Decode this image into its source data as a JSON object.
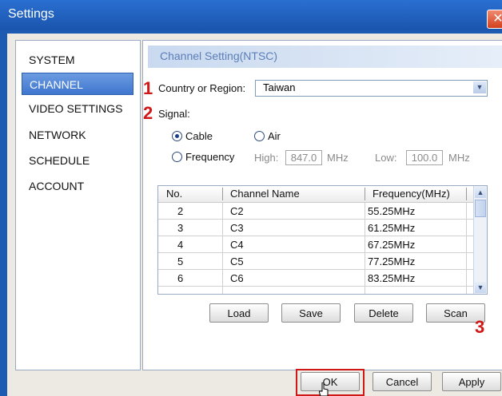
{
  "window": {
    "title": "Settings",
    "close_icon": "close-icon"
  },
  "sidebar": {
    "items": [
      {
        "label": "SYSTEM",
        "active": false
      },
      {
        "label": "CHANNEL",
        "active": true
      },
      {
        "label": "VIDEO SETTINGS",
        "active": false
      },
      {
        "label": "NETWORK",
        "active": false
      },
      {
        "label": "SCHEDULE",
        "active": false
      },
      {
        "label": "ACCOUNT",
        "active": false
      }
    ]
  },
  "panel": {
    "section_title": "Channel Setting(NTSC)",
    "country_label": "Country or Region:",
    "country_value": "Taiwan",
    "signal_label": "Signal:",
    "radio_cable": "Cable",
    "radio_air": "Air",
    "radio_frequency": "Frequency",
    "selected_signal": "Cable",
    "high_label": "High:",
    "high_value": "847.0",
    "high_unit": "MHz",
    "low_label": "Low:",
    "low_value": "100.0",
    "low_unit": "MHz"
  },
  "table": {
    "headers": [
      "No.",
      "Channel Name",
      "Frequency(MHz)"
    ],
    "rows": [
      [
        "2",
        "C2",
        "55.25MHz"
      ],
      [
        "3",
        "C3",
        "61.25MHz"
      ],
      [
        "4",
        "C4",
        "67.25MHz"
      ],
      [
        "5",
        "C5",
        "77.25MHz"
      ],
      [
        "6",
        "C6",
        "83.25MHz"
      ]
    ]
  },
  "actions": {
    "load": "Load",
    "save": "Save",
    "delete": "Delete",
    "scan": "Scan"
  },
  "footer": {
    "ok": "OK",
    "cancel": "Cancel",
    "apply": "Apply"
  },
  "annotations": {
    "step1": "1",
    "step2": "2",
    "step3": "3"
  },
  "colors": {
    "titlebar": "#1a55ad",
    "active_item": "#3f76cf",
    "annotation_red": "#d01818",
    "section_title": "#5b7fb8"
  }
}
